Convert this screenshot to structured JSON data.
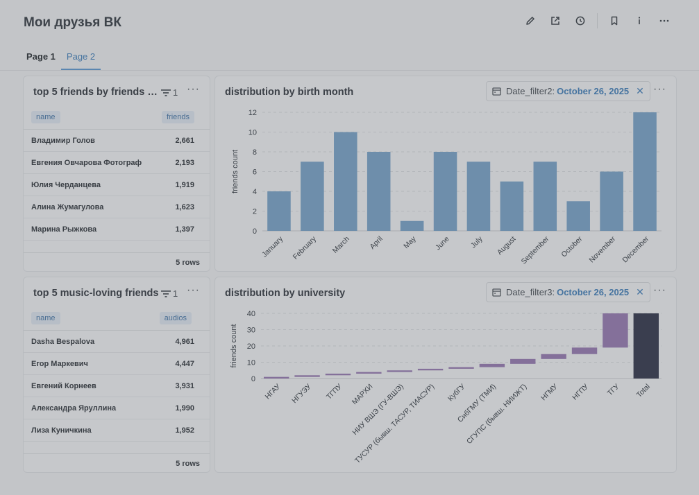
{
  "dashboard": {
    "title": "Мои друзья ВК"
  },
  "tabs": [
    {
      "label": "Page 1"
    },
    {
      "label": "Page 2"
    }
  ],
  "friends_card": {
    "title": "top 5 friends by friends co...",
    "filter_count": "1",
    "columns": {
      "name": "name",
      "value": "friends"
    },
    "rows": [
      {
        "name": "Владимир Голов",
        "value": "2,661"
      },
      {
        "name": "Евгения Овчарова Фотограф",
        "value": "2,193"
      },
      {
        "name": "Юлия Черданцева",
        "value": "1,919"
      },
      {
        "name": "Алина Жумагулова",
        "value": "1,623"
      },
      {
        "name": "Марина Рыжкова",
        "value": "1,397"
      }
    ],
    "footer": "5 rows"
  },
  "music_card": {
    "title": "top 5 music-loving friends",
    "filter_count": "1",
    "columns": {
      "name": "name",
      "value": "audios"
    },
    "rows": [
      {
        "name": "Dasha Bespalova",
        "value": "4,961"
      },
      {
        "name": "Егор Маркевич",
        "value": "4,447"
      },
      {
        "name": "Евгений Корнеев",
        "value": "3,931"
      },
      {
        "name": "Александра Яруллина",
        "value": "1,990"
      },
      {
        "name": "Лиза Куничкина",
        "value": "1,952"
      }
    ],
    "footer": "5 rows"
  },
  "month_card": {
    "title": "distribution by birth month",
    "filter_label": "Date_filter2:",
    "filter_value": "October 26, 2025"
  },
  "uni_card": {
    "title": "distribution by university",
    "filter_label": "Date_filter3:",
    "filter_value": "October 26, 2025"
  },
  "icons": [
    "pencil-icon",
    "share-icon",
    "clock-icon",
    "bookmark-icon",
    "info-icon",
    "more-icon",
    "filter-icon",
    "calendar-icon",
    "close-icon"
  ],
  "colors": {
    "bar": "#6e8eab",
    "waterfall": "#84709a",
    "total": "#3a3e4f",
    "accent": "#4674a0"
  },
  "chart_data": [
    {
      "type": "bar",
      "title": "distribution by birth month",
      "categories": [
        "January",
        "February",
        "March",
        "April",
        "May",
        "June",
        "July",
        "August",
        "September",
        "October",
        "November",
        "December"
      ],
      "values": [
        4,
        7,
        10,
        8,
        1,
        8,
        7,
        5,
        7,
        3,
        6,
        12
      ],
      "ylabel": "friends count",
      "ylim": [
        0,
        12
      ],
      "yticks": [
        0,
        2,
        4,
        6,
        8,
        10,
        12
      ],
      "grid": true
    },
    {
      "type": "bar",
      "subtype": "waterfall",
      "title": "distribution by university",
      "categories": [
        "НГАУ",
        "НГУЭУ",
        "ТГПУ",
        "МАРХИ",
        "НИУ ВШЭ (ГУ-ВШЭ)",
        "ТУСУР (бывш. ТАСУР, ТИАСУР)",
        "КубГУ",
        "СибГМУ (ТМИ)",
        "СГУПС (бывш. НИИЖТ)",
        "НГМУ",
        "НГПУ",
        "ТГУ",
        "Total"
      ],
      "values": [
        1,
        1,
        1,
        1,
        1,
        1,
        1,
        2,
        3,
        3,
        4,
        21,
        40
      ],
      "ylabel": "friends count",
      "ylim": [
        0,
        40
      ],
      "yticks": [
        0,
        10,
        20,
        30,
        40
      ],
      "grid": true
    }
  ]
}
